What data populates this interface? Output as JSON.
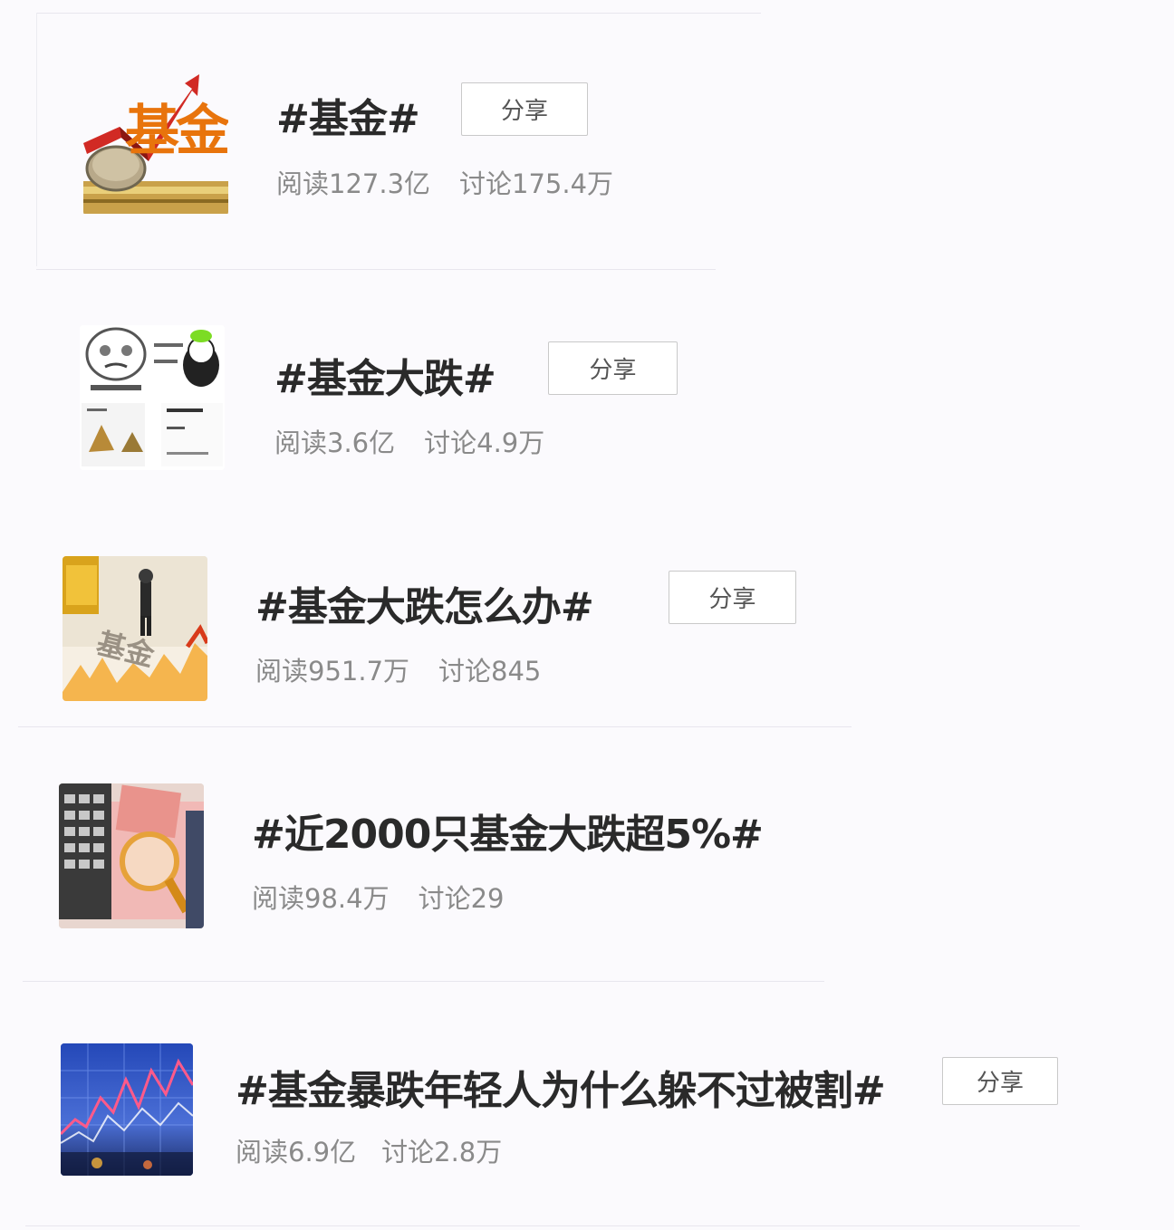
{
  "topics": [
    {
      "title": "#基金#",
      "read": "阅读127.3亿",
      "discuss": "讨论175.4万",
      "share": "分享",
      "thumb_text": "基金"
    },
    {
      "title": "#基金大跌#",
      "read": "阅读3.6亿",
      "discuss": "讨论4.9万",
      "share": "分享"
    },
    {
      "title": "#基金大跌怎么办#",
      "read": "阅读951.7万",
      "discuss": "讨论845",
      "share": "分享",
      "thumb_text": "基金"
    },
    {
      "title": "#近2000只基金大跌超5%#",
      "read": "阅读98.4万",
      "discuss": "讨论29"
    },
    {
      "title": "#基金暴跌年轻人为什么躲不过被割#",
      "read": "阅读6.9亿",
      "discuss": "讨论2.8万",
      "share": "分享"
    }
  ],
  "colors": {
    "accent": "#e8740c",
    "text": "#2a2a2a",
    "muted": "#8a8a8a",
    "border": "#c9c9c9"
  }
}
